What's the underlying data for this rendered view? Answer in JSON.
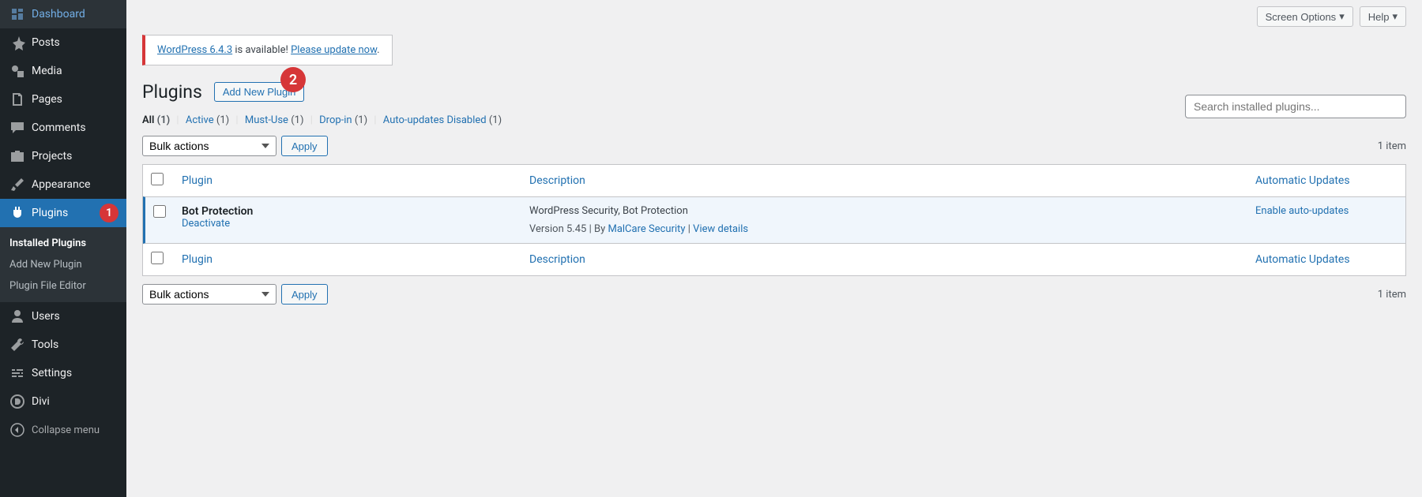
{
  "sidebar": {
    "items": [
      {
        "label": "Dashboard",
        "icon": "dashboard"
      },
      {
        "label": "Posts",
        "icon": "pin"
      },
      {
        "label": "Media",
        "icon": "media"
      },
      {
        "label": "Pages",
        "icon": "pages"
      },
      {
        "label": "Comments",
        "icon": "comment"
      },
      {
        "label": "Projects",
        "icon": "portfolio"
      },
      {
        "label": "Appearance",
        "icon": "brush"
      },
      {
        "label": "Plugins",
        "icon": "plug"
      },
      {
        "label": "Users",
        "icon": "user"
      },
      {
        "label": "Tools",
        "icon": "wrench"
      },
      {
        "label": "Settings",
        "icon": "sliders"
      },
      {
        "label": "Divi",
        "icon": "divi"
      }
    ],
    "plugins_badge": "1",
    "submenu": [
      {
        "label": "Installed Plugins"
      },
      {
        "label": "Add New Plugin"
      },
      {
        "label": "Plugin File Editor"
      }
    ],
    "collapse": "Collapse menu"
  },
  "topbar": {
    "screen_options": "Screen Options",
    "help": "Help"
  },
  "notice": {
    "link": "WordPress 6.4.3",
    "text": " is available! ",
    "link2": "Please update now",
    "period": "."
  },
  "header": {
    "title": "Plugins",
    "add_btn": "Add New Plugin",
    "badge": "2"
  },
  "filters": {
    "all": "All",
    "all_count": "(1)",
    "active": "Active",
    "active_count": "(1)",
    "mustuse": "Must-Use",
    "mustuse_count": "(1)",
    "dropin": "Drop-in",
    "dropin_count": "(1)",
    "auto": "Auto-updates Disabled",
    "auto_count": "(1)"
  },
  "search": {
    "placeholder": "Search installed plugins..."
  },
  "bulk": {
    "label": "Bulk actions",
    "apply": "Apply"
  },
  "item_count": "1 item",
  "table": {
    "col_plugin": "Plugin",
    "col_desc": "Description",
    "col_auto": "Automatic Updates",
    "plugin_name": "Bot Protection",
    "deactivate": "Deactivate",
    "desc": "WordPress Security, Bot Protection",
    "version_label": "Version 5.45",
    "by": "By",
    "author": "MalCare Security",
    "view_details": "View details",
    "enable_auto": "Enable auto-updates"
  }
}
